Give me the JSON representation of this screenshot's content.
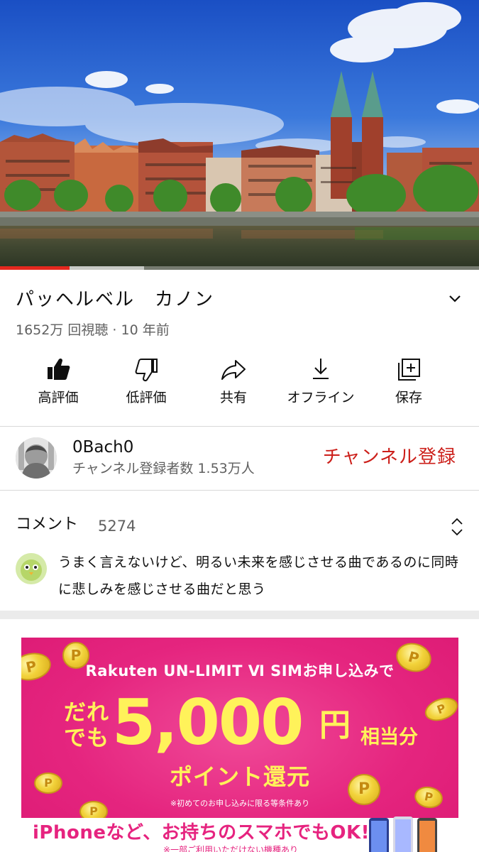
{
  "video": {
    "progress_percent": 14.5,
    "buffered_percent": 30
  },
  "title": "パッヘルベル　カノン",
  "meta": "1652万 回視聴 · 10 年前",
  "actions": [
    {
      "label": "高評価",
      "icon": "thumbs-up-icon"
    },
    {
      "label": "低評価",
      "icon": "thumbs-down-icon"
    },
    {
      "label": "共有",
      "icon": "share-icon"
    },
    {
      "label": "オフライン",
      "icon": "download-icon"
    },
    {
      "label": "保存",
      "icon": "save-playlist-icon"
    }
  ],
  "channel": {
    "name": "0Bach0",
    "subscribers": "チャンネル登録者数 1.53万人",
    "subscribe_label": "チャンネル登録"
  },
  "comments": {
    "label": "コメント",
    "count": "5274",
    "first_comment": "うまく言えないけど、明るい未来を感じさせる曲であるのに同時に悲しみを感じさせる曲だと思う"
  },
  "ad": {
    "brand_line": "Rakuten UN-LIMIT Ⅵ SIMお申し込みで",
    "pre": [
      "だれ",
      "でも"
    ],
    "amount": "5,000",
    "unit": "円",
    "suffix": "相当分",
    "point_line": "ポイント還元",
    "note": "※初めてのお申し込みに限る等条件あり",
    "bottom_line": "iPhoneなど、お持ちのスマホでもOK!",
    "bottom_sub": "※一部ご利用いただけない機種あり"
  },
  "colors": {
    "subscribe": "#cc1f1a",
    "progress": "#e5281e",
    "ad_background": "#e6237f",
    "ad_text": "#fff25a"
  }
}
